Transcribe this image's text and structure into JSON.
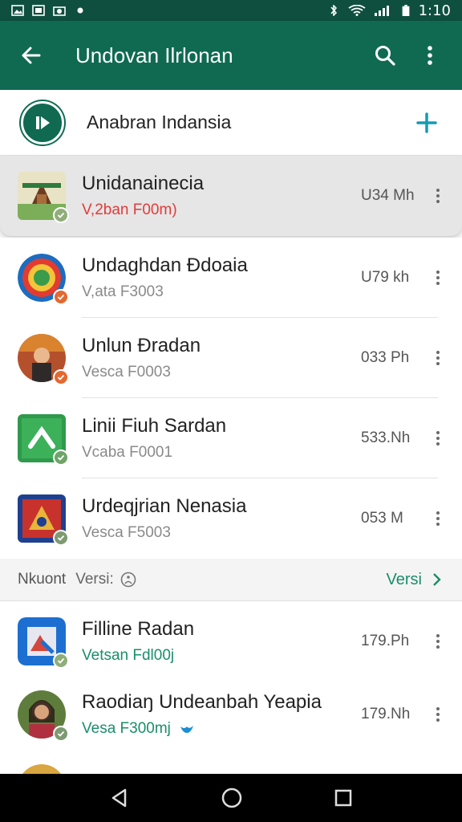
{
  "status_bar": {
    "time": "1:10",
    "icons": [
      "image-icon",
      "photo-icon",
      "camera-icon",
      "dot-icon",
      "bluetooth-icon",
      "wifi-icon",
      "signal-icon",
      "battery-icon"
    ]
  },
  "app_bar": {
    "title": "Undovan Ilrlonan",
    "icons": [
      "back-arrow-icon",
      "search-icon",
      "more-vert-icon"
    ],
    "color": "#0f6a51"
  },
  "header": {
    "label": "Anabran Indansia",
    "icons": [
      "logo-icon",
      "plus-icon"
    ]
  },
  "items": [
    {
      "name": "Unidanainecia",
      "sub": "V,2ban F00m)",
      "meta": "U34 Mh",
      "badge_color": "#8fae7a"
    },
    {
      "name": "Undaghdan Ðdoaia",
      "sub": "V,ata F3003",
      "meta": "U79 kh",
      "badge_color": "#e4682f"
    },
    {
      "name": "Unlun Ðradan",
      "sub": "Vesca F0003",
      "meta": "033 Ph",
      "badge_color": "#e4682f"
    },
    {
      "name": "Linii Fiuh Sardan",
      "sub": "Vcaba F0001",
      "meta": "533.Nh",
      "badge_color": "#6fa468"
    },
    {
      "name": "Urdeqjrian Nenasia",
      "sub": "Vesca F5003",
      "meta": "053 M",
      "badge_color": "#7d9a70"
    }
  ],
  "section": {
    "left_label": "Nkuont",
    "mid_label": "Versi:",
    "link": "Versi"
  },
  "items2": [
    {
      "name": "Filline Radan",
      "sub": "Vetsan Fdl00j",
      "meta": "179.Ph",
      "badge_color": "#8fae7a"
    },
    {
      "name": "Raodiaŋ Undeanbah Yeapia",
      "sub": "Vesa F300mj",
      "meta": "179.Nh",
      "badge_color": "#7d9a70"
    }
  ],
  "nav": [
    "back-triangle-icon",
    "home-circle-icon",
    "recent-square-icon"
  ]
}
